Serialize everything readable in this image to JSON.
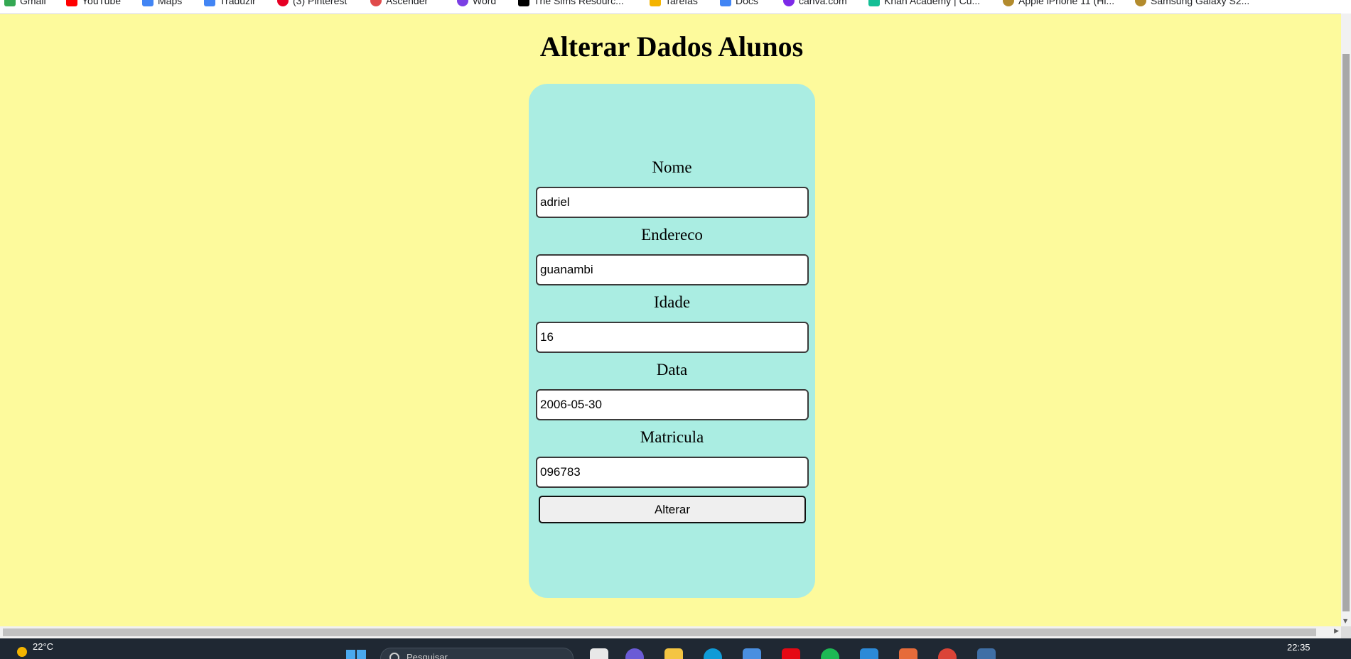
{
  "bookmarks": [
    {
      "label": "Gmail",
      "icon": "gmail-icon",
      "color": "#34a853"
    },
    {
      "label": "YouTube",
      "icon": "youtube-icon",
      "color": "#ff0000"
    },
    {
      "label": "Maps",
      "icon": "maps-icon",
      "color": "#4285f4"
    },
    {
      "label": "Traduzir",
      "icon": "translate-icon",
      "color": "#4285f4"
    },
    {
      "label": "(3) Pinterest",
      "icon": "pinterest-icon",
      "color": "#e60023"
    },
    {
      "label": "Ascender",
      "icon": "ascender-icon",
      "color": "#e04b4b"
    },
    {
      "label": "Word",
      "icon": "word-icon",
      "color": "#7b3fe4"
    },
    {
      "label": "The Sims Resourc...",
      "icon": "sims-icon",
      "color": "#000000"
    },
    {
      "label": "Tarefas",
      "icon": "tasks-icon",
      "color": "#f4b400"
    },
    {
      "label": "Docs",
      "icon": "docs-icon",
      "color": "#4285f4"
    },
    {
      "label": "canva.com",
      "icon": "canva-icon",
      "color": "#7d2ae8"
    },
    {
      "label": "Khan Academy | Cu...",
      "icon": "khan-academy-icon",
      "color": "#14bf96"
    },
    {
      "label": "Apple iPhone 11 (Hi...",
      "icon": "apple-product-icon",
      "color": "#b38b2d"
    },
    {
      "label": "Samsung Galaxy S2...",
      "icon": "samsung-product-icon",
      "color": "#b38b2d"
    }
  ],
  "page": {
    "title": "Alterar Dados Alunos"
  },
  "form": {
    "fields": [
      {
        "label": "Nome",
        "value": "adriel"
      },
      {
        "label": "Endereco",
        "value": "guanambi"
      },
      {
        "label": "Idade",
        "value": "16"
      },
      {
        "label": "Data",
        "value": "2006-05-30"
      },
      {
        "label": "Matricula",
        "value": "096783"
      }
    ],
    "submit_label": "Alterar"
  },
  "taskbar": {
    "temperature": "22°C",
    "search_placeholder": "Pesquisar",
    "time": "22:35",
    "apps": [
      {
        "icon": "file-explorer-icon",
        "color": "#f4c542"
      },
      {
        "icon": "edge-icon",
        "color": "#0f9bd7"
      },
      {
        "icon": "netflix-icon",
        "color": "#e50914"
      },
      {
        "icon": "spotify-icon",
        "color": "#1db954"
      },
      {
        "icon": "vscode-icon",
        "color": "#2c8ad8"
      },
      {
        "icon": "chrome-icon",
        "color": "#db4437"
      }
    ]
  },
  "colors": {
    "page_background": "#fdfa9c",
    "card_background": "#aaede2"
  }
}
